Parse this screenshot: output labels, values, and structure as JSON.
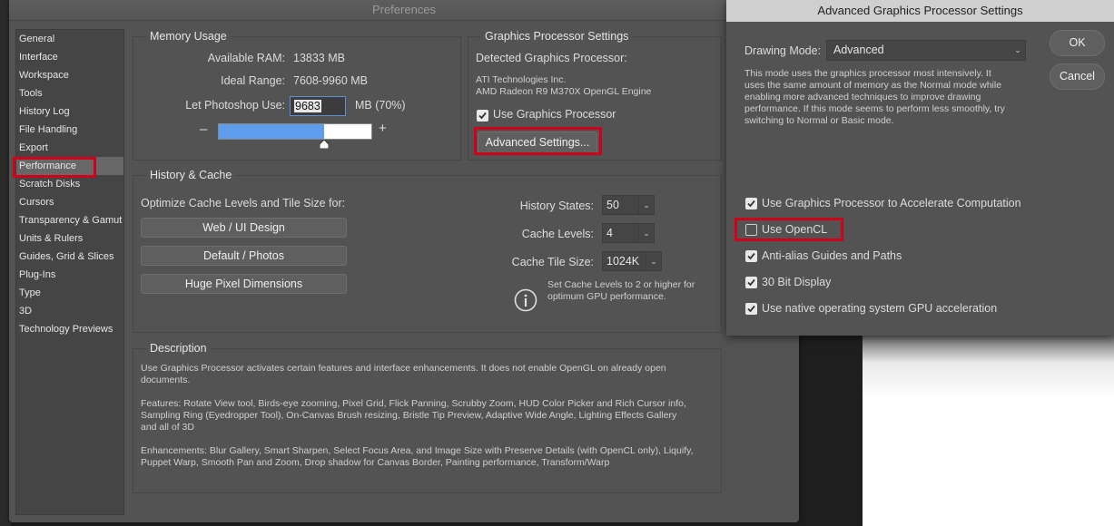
{
  "main_dialog": {
    "title": "Preferences",
    "sidebar": {
      "items": [
        "General",
        "Interface",
        "Workspace",
        "Tools",
        "History Log",
        "File Handling",
        "Export",
        "Performance",
        "Scratch Disks",
        "Cursors",
        "Transparency & Gamut",
        "Units & Rulers",
        "Guides, Grid & Slices",
        "Plug-Ins",
        "Type",
        "3D",
        "Technology Previews"
      ],
      "selected": "Performance"
    },
    "memory": {
      "title": "Memory Usage",
      "available_label": "Available RAM:",
      "available_value": "13833 MB",
      "ideal_label": "Ideal Range:",
      "ideal_value": "7608-9960 MB",
      "let_label": "Let Photoshop Use:",
      "let_value": "9683",
      "let_unit": "MB (70%)",
      "minus": "–",
      "plus": "+",
      "slider_fraction": 0.7
    },
    "gpu": {
      "title": "Graphics Processor Settings",
      "detected_label": "Detected Graphics Processor:",
      "vendor": "ATI Technologies Inc.",
      "model": "AMD Radeon R9 M370X OpenGL Engine",
      "use_label": "Use Graphics Processor",
      "use_checked": true,
      "advanced_button": "Advanced Settings..."
    },
    "history": {
      "title": "History & Cache",
      "optimize_label": "Optimize Cache Levels and Tile Size for:",
      "buttons": [
        "Web / UI Design",
        "Default / Photos",
        "Huge Pixel Dimensions"
      ],
      "history_states_label": "History States:",
      "history_states_value": "50",
      "cache_levels_label": "Cache Levels:",
      "cache_levels_value": "4",
      "tile_size_label": "Cache Tile Size:",
      "tile_size_value": "1024K",
      "info_line1": "Set Cache Levels to 2 or higher for",
      "info_line2": "optimum GPU performance."
    },
    "description": {
      "title": "Description",
      "p1_l1": "Use Graphics Processor activates certain features and interface enhancements. It does not enable OpenGL on already open",
      "p1_l2": "documents.",
      "p2_l1": "Features: Rotate View tool, Birds-eye zooming, Pixel Grid, Flick Panning, Scrubby Zoom, HUD Color Picker and Rich Cursor info,",
      "p2_l2": "Sampling Ring (Eyedropper Tool), On-Canvas Brush resizing, Bristle Tip Preview, Adaptive Wide Angle, Lighting Effects Gallery",
      "p2_l3": "and all of 3D",
      "p3_l1": "Enhancements: Blur Gallery, Smart Sharpen, Select Focus Area, and Image Size with Preserve Details (with OpenCL only), Liquify,",
      "p3_l2": "Puppet Warp, Smooth Pan and Zoom, Drop shadow for Canvas Border, Painting performance, Transform/Warp"
    }
  },
  "advanced_dialog": {
    "title": "Advanced Graphics Processor Settings",
    "drawing_mode_label": "Drawing Mode:",
    "drawing_mode_value": "Advanced",
    "mode_desc_l1": "This mode uses the graphics processor most intensively.  It",
    "mode_desc_l2": "uses the same amount of memory as the Normal mode while",
    "mode_desc_l3": "enabling more advanced techniques to improve drawing",
    "mode_desc_l4": "performance.  If this mode seems to perform less smoothly, try",
    "mode_desc_l5": "switching to Normal or Basic mode.",
    "ok": "OK",
    "cancel": "Cancel",
    "options": [
      {
        "label": "Use Graphics Processor to Accelerate Computation",
        "checked": true
      },
      {
        "label": "Use OpenCL",
        "checked": false
      },
      {
        "label": "Anti-alias Guides and Paths",
        "checked": true
      },
      {
        "label": "30 Bit Display",
        "checked": true
      },
      {
        "label": "Use native operating system GPU acceleration",
        "checked": true
      }
    ]
  },
  "colors": {
    "highlight": "#d0021b",
    "slider_fill": "#5e9cec"
  }
}
